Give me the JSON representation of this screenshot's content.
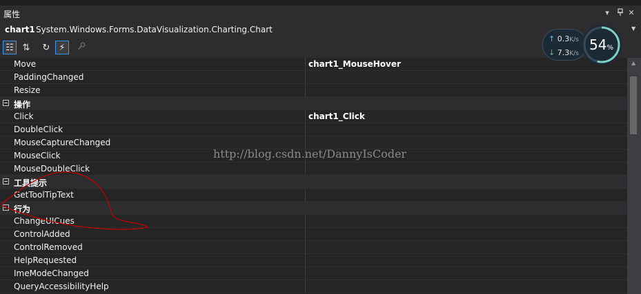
{
  "panel": {
    "title": "属性",
    "buttons": {
      "dropdown": "▾",
      "pin": "ᴘ",
      "close": "✕"
    }
  },
  "object": {
    "name": "chart1",
    "type": "System.Windows.Forms.DataVisualization.Charting.Chart"
  },
  "toolbar": {
    "buttons": [
      {
        "name": "categorized-button",
        "icon": "categorized-icon",
        "glyph": "☷",
        "active": true
      },
      {
        "name": "alphabetical-button",
        "icon": "sort-az-icon",
        "glyph": "⇅",
        "active": false
      },
      {
        "name": "properties-button",
        "icon": "wrench-icon",
        "glyph": "↻",
        "active": false
      },
      {
        "name": "events-button",
        "icon": "lightning-icon",
        "glyph": "⚡",
        "active": true
      },
      {
        "name": "property-pages-button",
        "icon": "key-icon",
        "glyph": "🔧",
        "active": false
      }
    ]
  },
  "rows": [
    {
      "kind": "item",
      "name": "Move",
      "value": "chart1_MouseHover"
    },
    {
      "kind": "item",
      "name": "PaddingChanged",
      "value": ""
    },
    {
      "kind": "item",
      "name": "Resize",
      "value": ""
    },
    {
      "kind": "category",
      "name": "操作",
      "value": ""
    },
    {
      "kind": "item",
      "name": "Click",
      "value": "chart1_Click"
    },
    {
      "kind": "item",
      "name": "DoubleClick",
      "value": ""
    },
    {
      "kind": "item",
      "name": "MouseCaptureChanged",
      "value": ""
    },
    {
      "kind": "item",
      "name": "MouseClick",
      "value": ""
    },
    {
      "kind": "item",
      "name": "MouseDoubleClick",
      "value": ""
    },
    {
      "kind": "category",
      "name": "工具提示",
      "value": ""
    },
    {
      "kind": "item",
      "name": "GetToolTipText",
      "value": ""
    },
    {
      "kind": "category",
      "name": "行为",
      "value": ""
    },
    {
      "kind": "item",
      "name": "ChangeUICues",
      "value": ""
    },
    {
      "kind": "item",
      "name": "ControlAdded",
      "value": ""
    },
    {
      "kind": "item",
      "name": "ControlRemoved",
      "value": ""
    },
    {
      "kind": "item",
      "name": "HelpRequested",
      "value": ""
    },
    {
      "kind": "item",
      "name": "ImeModeChanged",
      "value": ""
    },
    {
      "kind": "item",
      "name": "QueryAccessibilityHelp",
      "value": ""
    }
  ],
  "watermark": "http://blog.csdn.net/DannyIsCoder",
  "net_monitor": {
    "upload": "0.3",
    "upload_unit": "K/s",
    "download": "7.3",
    "download_unit": "K/s",
    "usage_percent": 54,
    "usage_label": "54",
    "percent_sign": "%"
  },
  "colors": {
    "background": "#2d2d30",
    "grid": "#252526",
    "accent": "#3399ff",
    "scribble": "#c00000",
    "gauge_ring": "#7ecfc0"
  }
}
